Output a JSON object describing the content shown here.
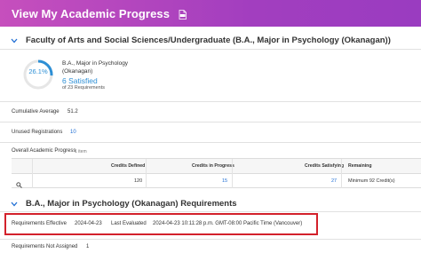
{
  "header": {
    "title": "View My Academic Progress",
    "pdf_icon": "pdf-icon"
  },
  "program_section": {
    "title": "Faculty of Arts and Social Sciences/Undergraduate (B.A., Major in Psychology (Okanagan))",
    "donut_percent": "26.1%",
    "donut_fraction": 0.261,
    "program_name": "B.A., Major in Psychology (Okanagan)",
    "satisfied": "6 Satisfied",
    "of_requirements": "of 23 Requirements"
  },
  "fields": {
    "cumulative_average_label": "Cumulative Average",
    "cumulative_average_value": "51.2",
    "unused_registrations_label": "Unused Registrations",
    "unused_registrations_value": "10",
    "overall_progress_label": "Overall Academic Progress",
    "overall_progress_count": "1 item"
  },
  "table": {
    "headers": [
      "Credits Defined",
      "Credits in Progress",
      "Credits Satisfying",
      "Remaining"
    ],
    "row": {
      "credits_defined": "120",
      "credits_in_progress": "15",
      "credits_satisfying": "27",
      "remaining": "Minimum 92 Credit(s)"
    }
  },
  "requirements_section": {
    "title": "B.A., Major in Psychology (Okanagan) Requirements",
    "effective_label": "Requirements Effective",
    "effective_value": "2024-04-23",
    "last_evaluated_label": "Last Evaluated",
    "last_evaluated_value": "2024-04-23 10:11:28 p.m. GMT-08:00 Pacific Time (Vancouver)",
    "not_assigned_label": "Requirements Not Assigned",
    "not_assigned_value": "1"
  },
  "colors": {
    "header_gradient_start": "#c64fbd",
    "header_gradient_end": "#9a3cc0",
    "link_blue": "#1f6ed4",
    "donut_blue": "#2d8fd5",
    "highlight_red": "#d3212b"
  }
}
